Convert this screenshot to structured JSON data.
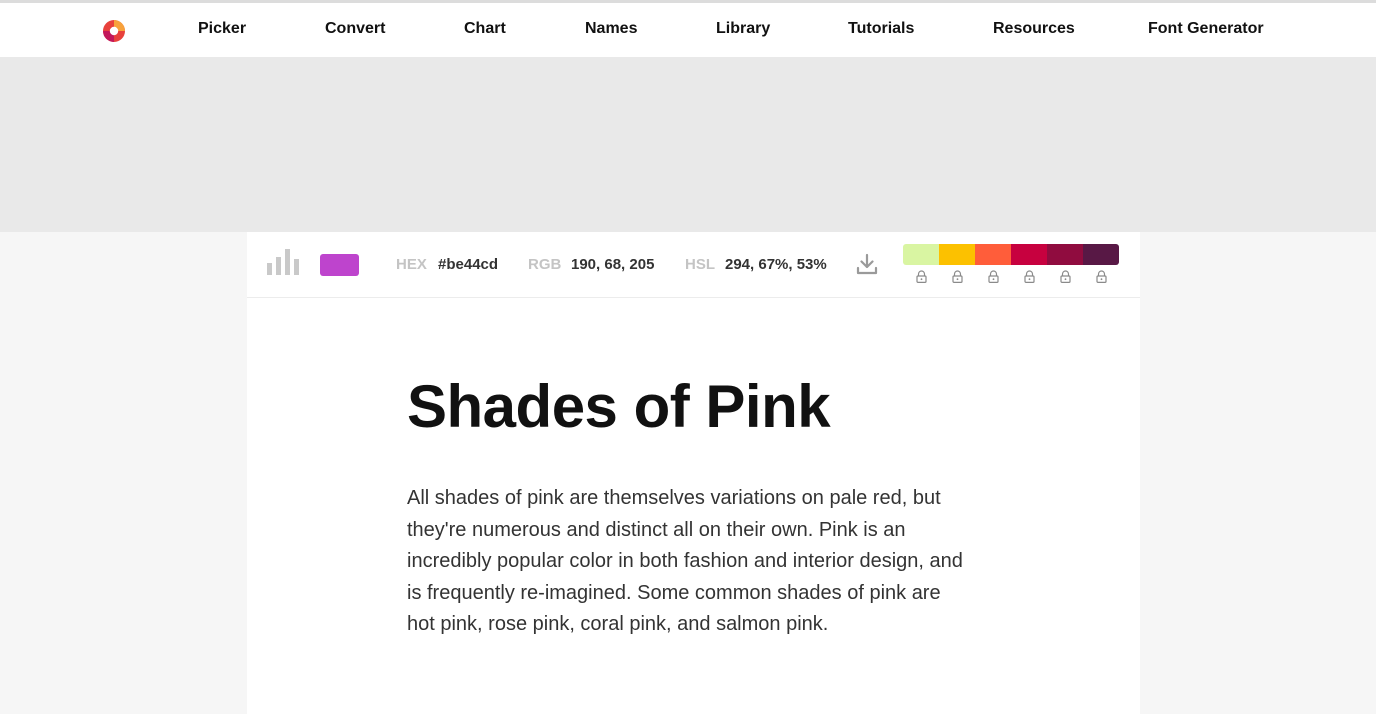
{
  "nav": {
    "items": [
      {
        "label": "Picker"
      },
      {
        "label": "Convert"
      },
      {
        "label": "Chart"
      },
      {
        "label": "Names"
      },
      {
        "label": "Library"
      },
      {
        "label": "Tutorials"
      },
      {
        "label": "Resources"
      },
      {
        "label": "Font Generator"
      }
    ]
  },
  "toolbar": {
    "current_color": "#be44cd",
    "hex_label": "HEX",
    "hex_value": "#be44cd",
    "rgb_label": "RGB",
    "rgb_value": "190, 68, 205",
    "hsl_label": "HSL",
    "hsl_value": "294, 67%, 53%",
    "palette": [
      "#d9f5a2",
      "#fcc100",
      "#ff5d3a",
      "#c7013f",
      "#900c3f",
      "#581845"
    ]
  },
  "content": {
    "title": "Shades of Pink",
    "description": "All shades of pink are themselves variations on pale red, but they're numerous and distinct all on their own. Pink is an incredibly popular color in both fashion and interior design, and is frequently re-imagined. Some common shades of pink are hot pink, rose pink, coral pink, and salmon pink."
  }
}
